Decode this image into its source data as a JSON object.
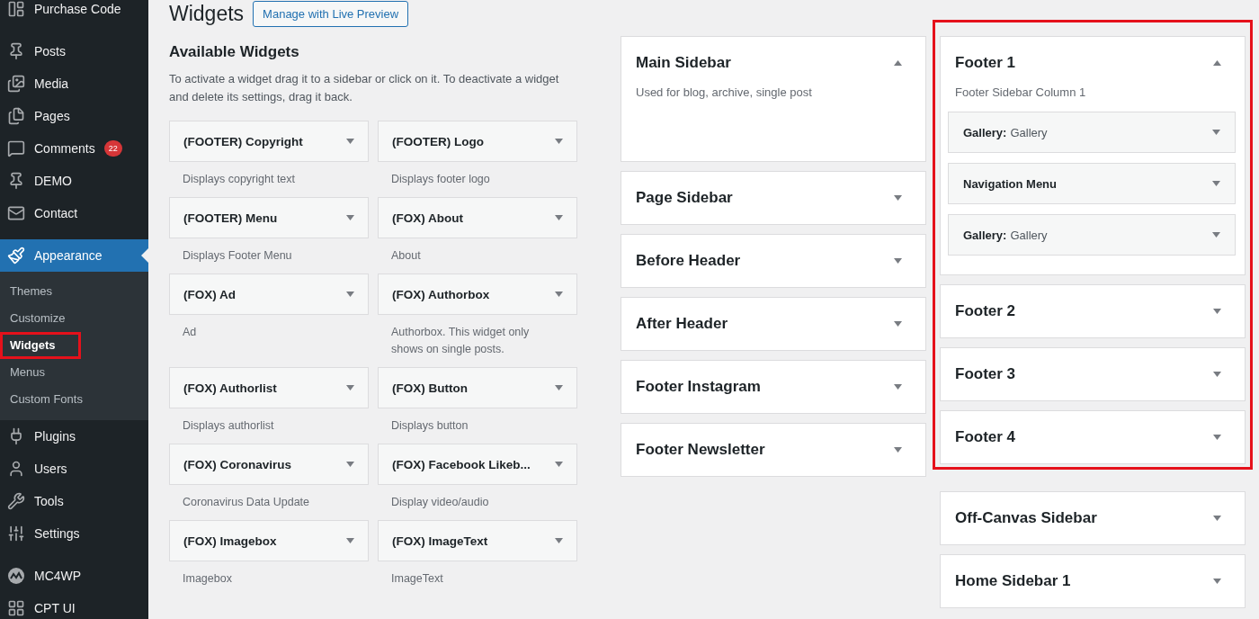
{
  "admin_menu": {
    "groups": [
      {
        "items": [
          {
            "label": "Purchase Code",
            "selected": false
          }
        ]
      },
      {
        "items": [
          {
            "label": "Posts",
            "selected": false
          },
          {
            "label": "Media",
            "selected": false
          },
          {
            "label": "Pages",
            "selected": false
          },
          {
            "label": "Comments",
            "selected": false,
            "badge": "22"
          },
          {
            "label": "DEMO",
            "selected": false
          },
          {
            "label": "Contact",
            "selected": false
          }
        ]
      },
      {
        "items": [
          {
            "label": "Appearance",
            "selected": true,
            "children": [
              {
                "label": "Themes",
                "selected": false,
                "highlighted": false
              },
              {
                "label": "Customize",
                "selected": false,
                "highlighted": false
              },
              {
                "label": "Widgets",
                "selected": true,
                "highlighted": true
              },
              {
                "label": "Menus",
                "selected": false,
                "highlighted": false
              },
              {
                "label": "Custom Fonts",
                "selected": false,
                "highlighted": false
              }
            ]
          },
          {
            "label": "Plugins",
            "selected": false
          },
          {
            "label": "Users",
            "selected": false
          },
          {
            "label": "Tools",
            "selected": false
          },
          {
            "label": "Settings",
            "selected": false
          }
        ]
      },
      {
        "items": [
          {
            "label": "MC4WP",
            "selected": false
          },
          {
            "label": "CPT UI",
            "selected": false
          }
        ]
      }
    ]
  },
  "page": {
    "title": "Widgets",
    "action_button": "Manage with Live Preview"
  },
  "available_widgets": {
    "heading": "Available Widgets",
    "description": "To activate a widget drag it to a sidebar or click on it. To deactivate a widget and delete its settings, drag it back.",
    "widgets": [
      {
        "title": "(FOOTER) Copyright",
        "description": "Displays copyright text"
      },
      {
        "title": "(FOOTER) Logo",
        "description": "Displays footer logo"
      },
      {
        "title": "(FOOTER) Menu",
        "description": "Displays Footer Menu"
      },
      {
        "title": "(FOX) About",
        "description": "About"
      },
      {
        "title": "(FOX) Ad",
        "description": "Ad"
      },
      {
        "title": "(FOX) Authorbox",
        "description": "Authorbox. This widget only shows on single posts."
      },
      {
        "title": "(FOX) Authorlist",
        "description": "Displays authorlist"
      },
      {
        "title": "(FOX) Button",
        "description": "Displays button"
      },
      {
        "title": "(FOX) Coronavirus",
        "description": "Coronavirus Data Update"
      },
      {
        "title": "(FOX) Facebook Likeb...",
        "description": "Display video/audio"
      },
      {
        "title": "(FOX) Imagebox",
        "description": "Imagebox"
      },
      {
        "title": "(FOX) ImageText",
        "description": "ImageText"
      }
    ]
  },
  "sidebar_areas": {
    "column_1": [
      {
        "title": "Main Sidebar",
        "expanded": true,
        "description": "Used for blog, archive, single post"
      },
      {
        "title": "Page Sidebar",
        "expanded": false
      },
      {
        "title": "Before Header",
        "expanded": false
      },
      {
        "title": "After Header",
        "expanded": false
      },
      {
        "title": "Footer Instagram",
        "expanded": false
      },
      {
        "title": "Footer Newsletter",
        "expanded": false
      }
    ],
    "column_2": [
      {
        "highlighted": true,
        "areas": [
          {
            "title": "Footer 1",
            "expanded": true,
            "description": "Footer Sidebar Column 1",
            "widgets": [
              {
                "title": "Gallery:",
                "instance_title": "Gallery"
              },
              {
                "title": "Navigation Menu"
              },
              {
                "title": "Gallery:",
                "instance_title": "Gallery"
              }
            ]
          },
          {
            "title": "Footer 2",
            "expanded": false
          },
          {
            "title": "Footer 3",
            "expanded": false
          },
          {
            "title": "Footer 4",
            "expanded": false
          }
        ]
      },
      {
        "highlighted": false,
        "areas": [
          {
            "title": "Off-Canvas Sidebar",
            "expanded": false
          },
          {
            "title": "Home Sidebar 1",
            "expanded": false
          }
        ]
      }
    ]
  }
}
